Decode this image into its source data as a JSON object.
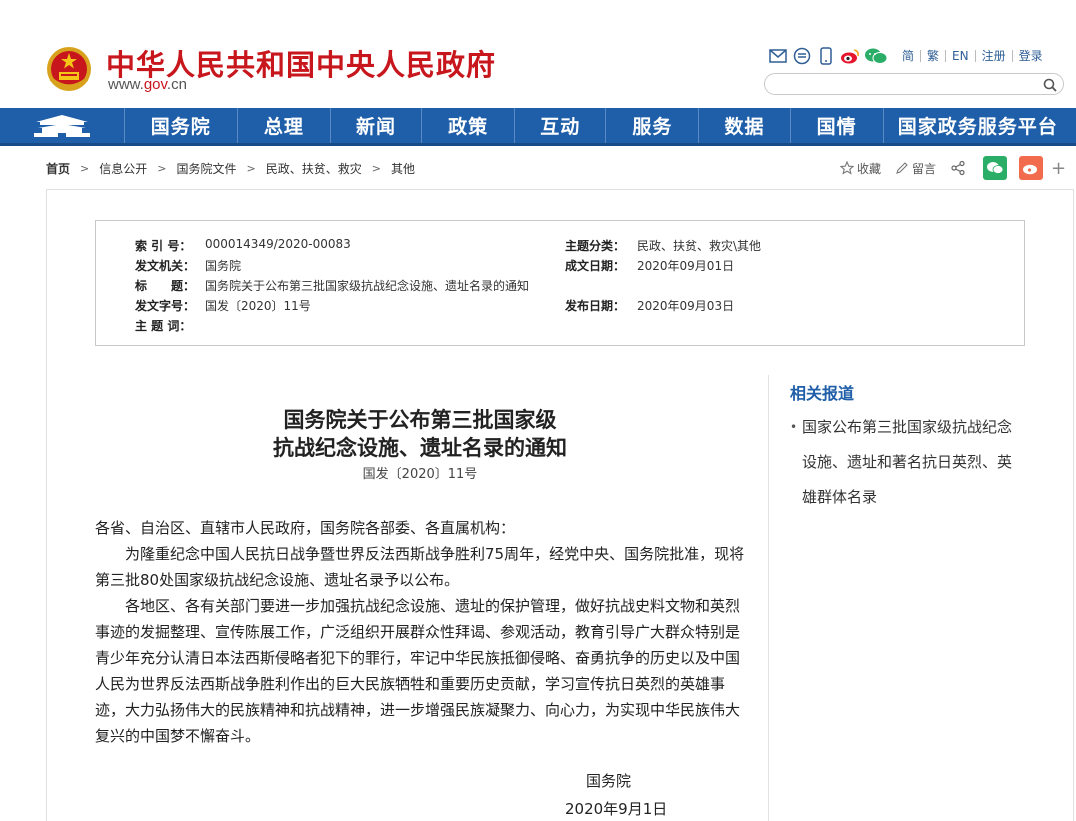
{
  "header": {
    "site_title": "中华人民共和国中央人民政府",
    "site_url_prefix": "www.",
    "site_url_brand": "gov",
    "site_url_suffix": ".cn",
    "tools": [
      "简",
      "繁",
      "EN",
      "注册",
      "登录"
    ],
    "search_placeholder": ""
  },
  "nav": {
    "items": [
      "国务院",
      "总理",
      "新闻",
      "政策",
      "互动",
      "服务",
      "数据",
      "国情",
      "国家政务服务平台"
    ]
  },
  "breadcrumb": [
    "首页",
    "信息公开",
    "国务院文件",
    "民政、扶贫、救灾",
    "其他"
  ],
  "share": {
    "favorite": "收藏",
    "message": "留言"
  },
  "meta": {
    "index_label": "索 引 号：",
    "index_value": "000014349/2020-00083",
    "topic_label": "主题分类：",
    "topic_value": "民政、扶贫、救灾\\其他",
    "issuer_label": "发文机关：",
    "issuer_value": "国务院",
    "created_label": "成文日期：",
    "created_value": "2020年09月01日",
    "title_label": "标　　题：",
    "title_value": "国务院关于公布第三批国家级抗战纪念设施、遗址名录的通知",
    "docno_label": "发文字号：",
    "docno_value": "国发〔2020〕11号",
    "published_label": "发布日期：",
    "published_value": "2020年09月03日",
    "subject_label": "主 题 词："
  },
  "article": {
    "title_line1": "国务院关于公布第三批国家级",
    "title_line2": "抗战纪念设施、遗址名录的通知",
    "doc_number": "国发〔2020〕11号",
    "salutation": "各省、自治区、直辖市人民政府，国务院各部委、各直属机构：",
    "para1": "为隆重纪念中国人民抗日战争暨世界反法西斯战争胜利75周年，经党中央、国务院批准，现将第三批80处国家级抗战纪念设施、遗址名录予以公布。",
    "para2": "各地区、各有关部门要进一步加强抗战纪念设施、遗址的保护管理，做好抗战史料文物和英烈事迹的发掘整理、宣传陈展工作，广泛组织开展群众性拜谒、参观活动，教育引导广大群众特别是青少年充分认清日本法西斯侵略者犯下的罪行，牢记中华民族抵御侵略、奋勇抗争的历史以及中国人民为世界反法西斯战争胜利作出的巨大民族牺牲和重要历史贡献，学习宣传抗日英烈的英雄事迹，大力弘扬伟大的民族精神和抗战精神，进一步增强民族凝聚力、向心力，为实现中华民族伟大复兴的中国梦不懈奋斗。",
    "signature": "国务院",
    "date": "2020年9月1日"
  },
  "sidebar": {
    "title": "相关报道",
    "items": [
      "国家公布第三批国家级抗战纪念设施、遗址和著名抗日英烈、英雄群体名录"
    ]
  },
  "colors": {
    "brand_red": "#c8161d",
    "nav_blue": "#1f5ea8",
    "wechat_green": "#2aae67",
    "weibo_orange": "#f26b4d"
  },
  "icons": [
    "national-emblem-icon",
    "mail-icon",
    "rss-icon",
    "mobile-icon",
    "weibo-icon",
    "wechat-icon",
    "search-icon",
    "tiananmen-home-icon",
    "star-icon",
    "pencil-icon",
    "share-icon",
    "plus-icon"
  ]
}
